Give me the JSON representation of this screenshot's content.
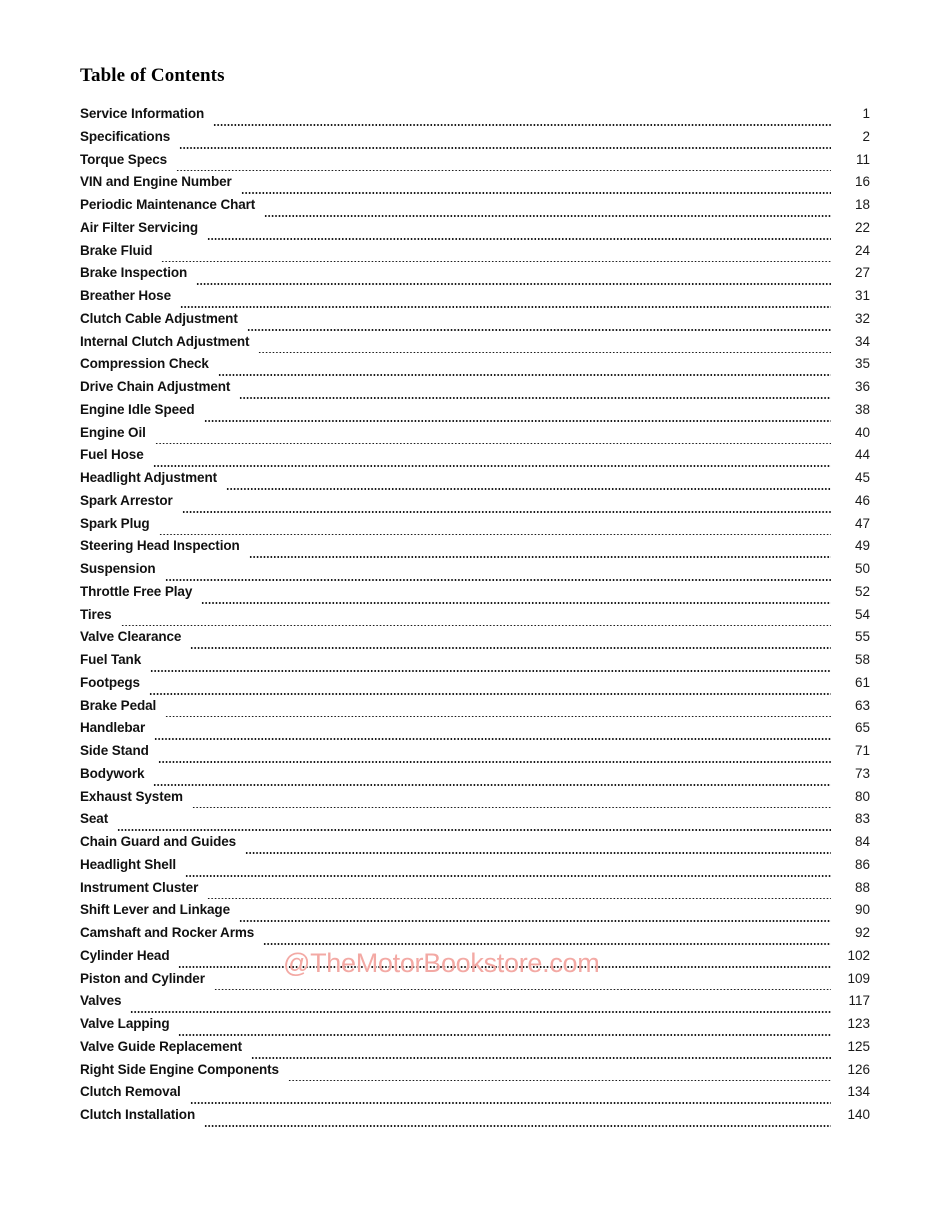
{
  "page": {
    "title": "Table of Contents",
    "background_color": "#ffffff",
    "text_color": "#111111"
  },
  "watermark": {
    "text": "@TheMotorBookstore.com",
    "color": "#f3a9a4"
  },
  "toc": {
    "entries": [
      {
        "label": "Service Information",
        "page": "1"
      },
      {
        "label": "Specifications",
        "page": "2"
      },
      {
        "label": "Torque Specs",
        "page": "11"
      },
      {
        "label": "VIN and Engine Number",
        "page": "16"
      },
      {
        "label": "Periodic Maintenance Chart",
        "page": "18"
      },
      {
        "label": "Air Filter Servicing",
        "page": "22"
      },
      {
        "label": "Brake Fluid",
        "page": "24"
      },
      {
        "label": "Brake Inspection",
        "page": "27"
      },
      {
        "label": "Breather Hose",
        "page": "31"
      },
      {
        "label": "Clutch Cable Adjustment",
        "page": "32"
      },
      {
        "label": "Internal Clutch Adjustment",
        "page": "34"
      },
      {
        "label": "Compression Check",
        "page": "35"
      },
      {
        "label": "Drive Chain Adjustment",
        "page": "36"
      },
      {
        "label": "Engine Idle Speed",
        "page": "38"
      },
      {
        "label": "Engine Oil",
        "page": "40"
      },
      {
        "label": "Fuel Hose",
        "page": "44"
      },
      {
        "label": "Headlight Adjustment",
        "page": "45"
      },
      {
        "label": "Spark Arrestor",
        "page": "46"
      },
      {
        "label": "Spark Plug",
        "page": "47"
      },
      {
        "label": "Steering Head Inspection",
        "page": "49"
      },
      {
        "label": "Suspension",
        "page": "50"
      },
      {
        "label": "Throttle Free Play",
        "page": "52"
      },
      {
        "label": "Tires",
        "page": "54"
      },
      {
        "label": "Valve Clearance",
        "page": "55"
      },
      {
        "label": "Fuel Tank",
        "page": "58"
      },
      {
        "label": "Footpegs",
        "page": "61"
      },
      {
        "label": "Brake Pedal",
        "page": "63"
      },
      {
        "label": "Handlebar",
        "page": "65"
      },
      {
        "label": "Side Stand",
        "page": "71"
      },
      {
        "label": "Bodywork",
        "page": "73"
      },
      {
        "label": "Exhaust System",
        "page": "80"
      },
      {
        "label": "Seat",
        "page": "83"
      },
      {
        "label": "Chain Guard and Guides",
        "page": "84"
      },
      {
        "label": "Headlight Shell",
        "page": "86"
      },
      {
        "label": "Instrument Cluster",
        "page": "88"
      },
      {
        "label": "Shift Lever and Linkage",
        "page": "90"
      },
      {
        "label": "Camshaft and Rocker Arms",
        "page": "92"
      },
      {
        "label": "Cylinder Head",
        "page": "102"
      },
      {
        "label": "Piston and Cylinder",
        "page": "109"
      },
      {
        "label": "Valves",
        "page": "117"
      },
      {
        "label": "Valve Lapping",
        "page": "123"
      },
      {
        "label": "Valve Guide Replacement",
        "page": "125"
      },
      {
        "label": "Right Side Engine Components",
        "page": "126"
      },
      {
        "label": "Clutch Removal",
        "page": "134"
      },
      {
        "label": "Clutch Installation",
        "page": "140"
      }
    ]
  }
}
